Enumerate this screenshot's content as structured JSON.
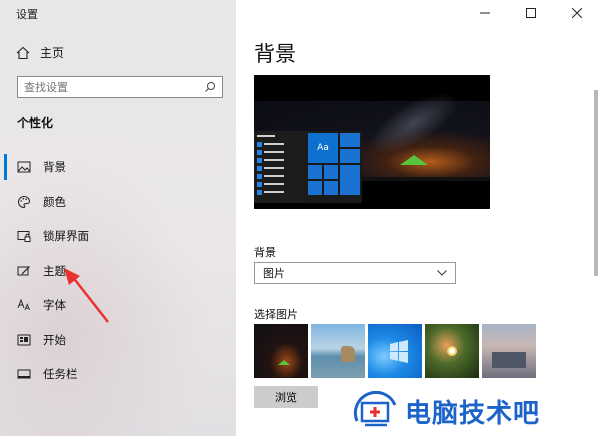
{
  "window": {
    "title": "设置"
  },
  "sidebar": {
    "home_label": "主页",
    "search_placeholder": "查找设置",
    "section_heading": "个性化",
    "items": [
      {
        "label": "背景",
        "icon": "picture-icon",
        "active": true
      },
      {
        "label": "颜色",
        "icon": "palette-icon",
        "active": false
      },
      {
        "label": "锁屏界面",
        "icon": "lock-screen-icon",
        "active": false
      },
      {
        "label": "主题",
        "icon": "theme-brush-icon",
        "active": false
      },
      {
        "label": "字体",
        "icon": "font-icon",
        "active": false
      },
      {
        "label": "开始",
        "icon": "start-icon",
        "active": false
      },
      {
        "label": "任务栏",
        "icon": "taskbar-icon",
        "active": false
      }
    ]
  },
  "main": {
    "title": "背景",
    "preview_tile_text": "Aa",
    "background_label": "背景",
    "background_value": "图片",
    "choose_picture_label": "选择图片",
    "browse_label": "浏览"
  },
  "watermark": {
    "text": "电脑技术吧"
  },
  "colors": {
    "accent": "#0078d7",
    "watermark": "#1c63c9",
    "annotation_arrow": "#e8322f"
  }
}
